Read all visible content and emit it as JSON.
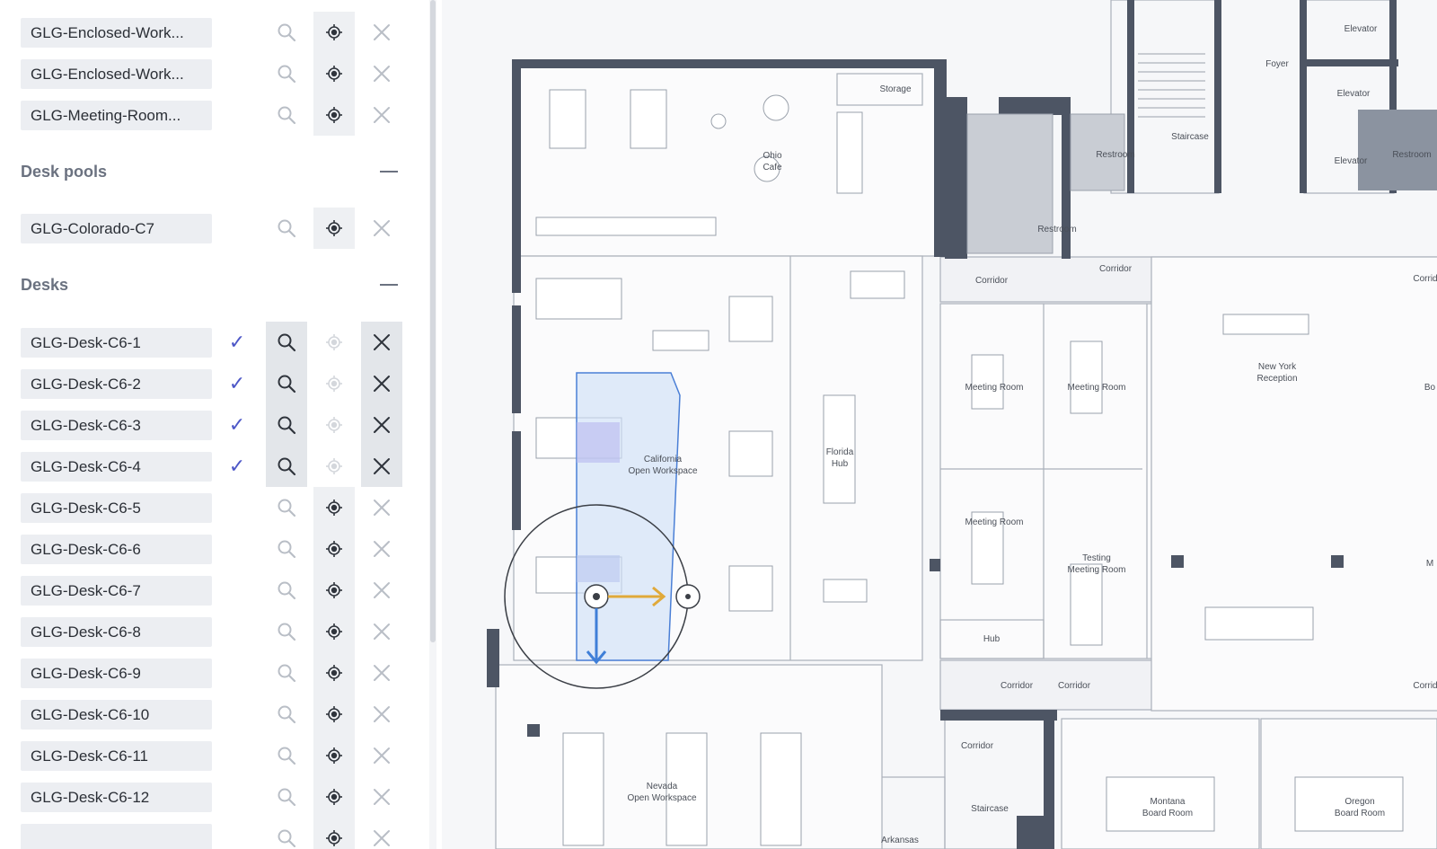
{
  "panel": {
    "workspaces": [
      {
        "label": "GLG-Enclosed-Work..."
      },
      {
        "label": "GLG-Enclosed-Work..."
      },
      {
        "label": "GLG-Meeting-Room..."
      }
    ],
    "desk_pools_heading": "Desk pools",
    "desk_pools": [
      {
        "label": "GLG-Colorado-C7"
      }
    ],
    "desks_heading": "Desks",
    "desks": [
      {
        "label": "GLG-Desk-C6-1",
        "selected": true
      },
      {
        "label": "GLG-Desk-C6-2",
        "selected": true
      },
      {
        "label": "GLG-Desk-C6-3",
        "selected": true
      },
      {
        "label": "GLG-Desk-C6-4",
        "selected": true
      },
      {
        "label": "GLG-Desk-C6-5",
        "selected": false
      },
      {
        "label": "GLG-Desk-C6-6",
        "selected": false
      },
      {
        "label": "GLG-Desk-C6-7",
        "selected": false
      },
      {
        "label": "GLG-Desk-C6-8",
        "selected": false
      },
      {
        "label": "GLG-Desk-C6-9",
        "selected": false
      },
      {
        "label": "GLG-Desk-C6-10",
        "selected": false
      },
      {
        "label": "GLG-Desk-C6-11",
        "selected": false
      },
      {
        "label": "GLG-Desk-C6-12",
        "selected": false
      }
    ],
    "check_glyph": "✓",
    "icons": {
      "search": "search-icon",
      "locate": "locate-icon",
      "remove": "close-icon"
    }
  },
  "map": {
    "rooms": {
      "elevator_1": "Elevator",
      "elevator_2": "Elevator",
      "elevator_3": "Elevator",
      "foyer": "Foyer",
      "storage": "Storage",
      "staircase_top": "Staircase",
      "restroom_1": "Restroom",
      "restroom_2": "Restroom",
      "restroom_3": "Restroom",
      "ohio_cafe_1": "Ohio",
      "ohio_cafe_2": "Cafe",
      "corridor_1": "Corridor",
      "corridor_2": "Corridor",
      "corridor_3": "Corrid",
      "corridor_4": "Corridor",
      "corridor_5": "Corridor",
      "corridor_6": "Corrid",
      "corridor_7": "Corridor",
      "meeting_1": "Meeting Room",
      "meeting_2": "Meeting Room",
      "meeting_3": "Meeting Room",
      "testing_1": "Testing",
      "testing_2": "Meeting Room",
      "new_york_1": "New York",
      "new_york_2": "Reception",
      "florida_1": "Florida",
      "florida_2": "Hub",
      "california_1": "California",
      "california_2": "Open Workspace",
      "hub": "Hub",
      "nevada_1": "Nevada",
      "nevada_2": "Open Workspace",
      "montana_1": "Montana",
      "montana_2": "Board Room",
      "oregon_1": "Oregon",
      "oregon_2": "Board Room",
      "staircase_bottom": "Staircase",
      "arkansas": "Arkansas",
      "bo": "Bo",
      "m": "M"
    }
  },
  "colors": {
    "wall": "#4d5564",
    "selection_fill": "#cfe0f7",
    "selection_stroke": "#4a7fd6",
    "gizmo_x": "#e0a93a",
    "gizmo_y": "#3f7fd8",
    "check": "#4d57c7"
  }
}
